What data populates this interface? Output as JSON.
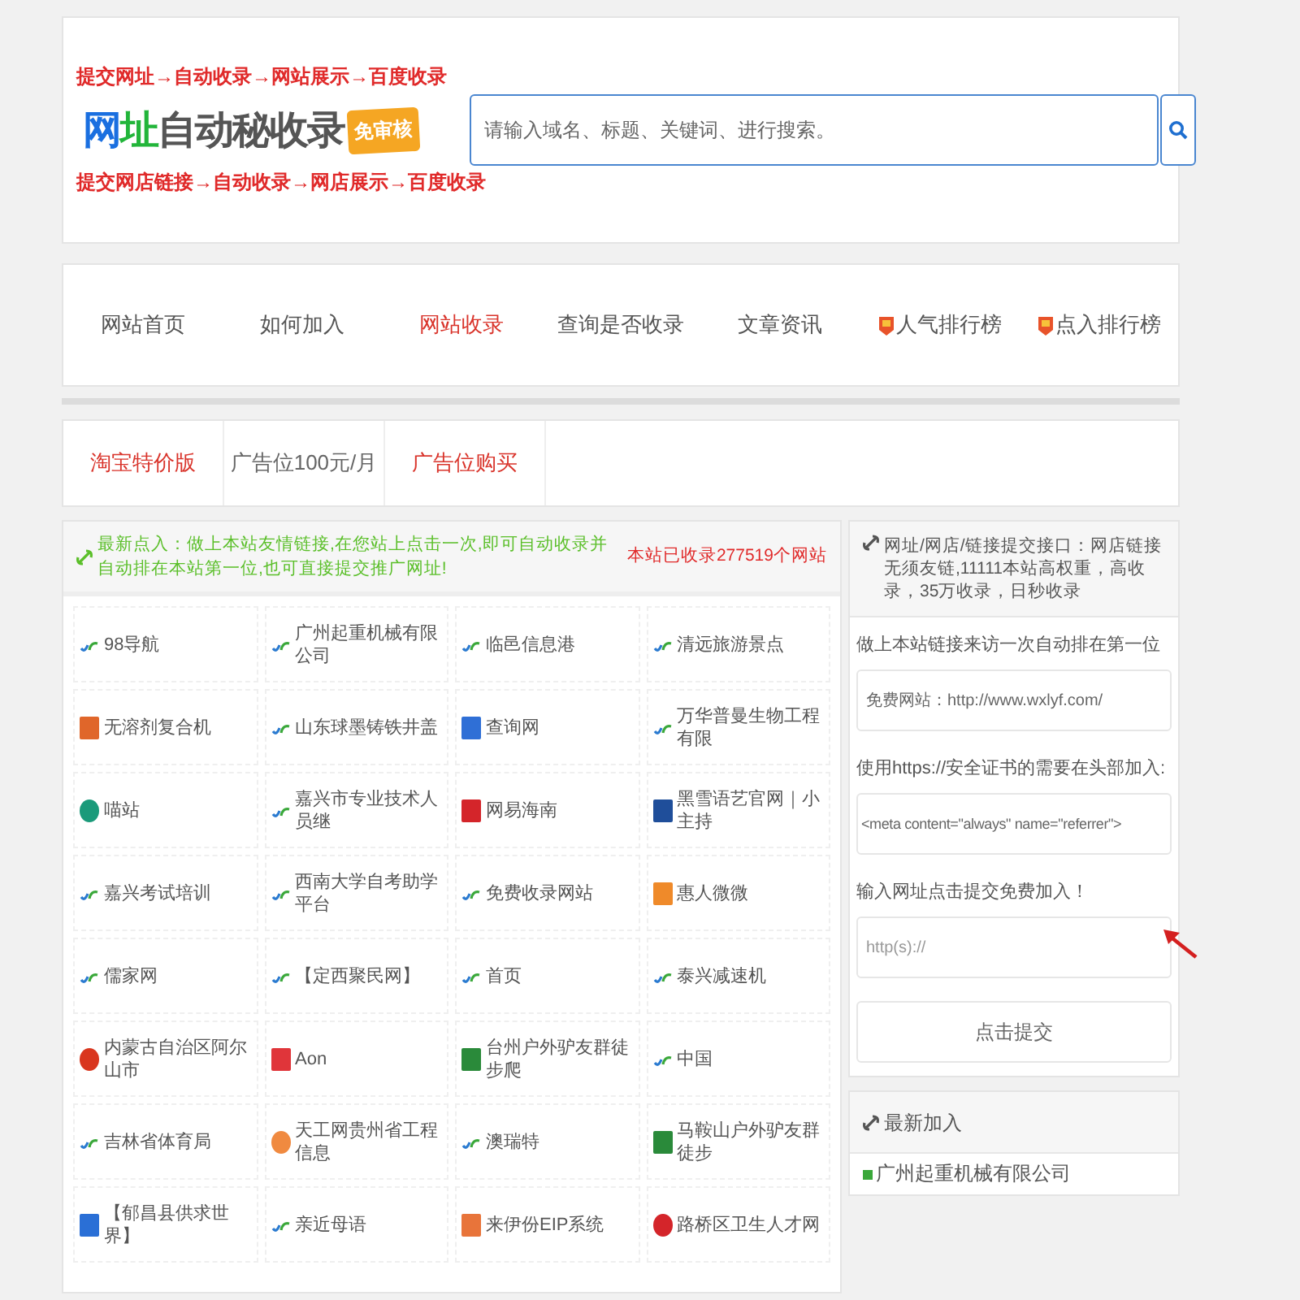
{
  "header": {
    "slogan_top": "提交网址→自动收录→网站展示→百度收录",
    "logo": {
      "parts": [
        {
          "text": "网",
          "color": "#1a6fe0"
        },
        {
          "text": "址",
          "color": "#22b53a"
        },
        {
          "text": "自动秘收录",
          "color": "#555555"
        }
      ],
      "badge": "免审核"
    },
    "slogan_bottom": "提交网店链接→自动收录→网店展示→百度收录",
    "search": {
      "placeholder": "请输入域名、标题、关键词、进行搜索。"
    }
  },
  "nav": [
    {
      "label": "网站首页",
      "selected": false,
      "kind": "plain"
    },
    {
      "label": "如何加入",
      "selected": false,
      "kind": "plain"
    },
    {
      "label": "网站收录",
      "selected": true,
      "kind": "plain"
    },
    {
      "label": "查询是否收录",
      "selected": false,
      "kind": "plain"
    },
    {
      "label": "文章资讯",
      "selected": false,
      "kind": "plain"
    },
    {
      "label": "人气排行榜",
      "selected": false,
      "kind": "hot"
    },
    {
      "label": "点入排行榜",
      "selected": false,
      "kind": "hot"
    }
  ],
  "ad_bar": [
    {
      "label": "淘宝特价版",
      "highlight": true
    },
    {
      "label": "广告位100元/月",
      "highlight": false
    },
    {
      "label": "广告位购买",
      "highlight": true
    }
  ],
  "notice": {
    "text": "最新点入：做上本站友情链接,在您站上点击一次,即可自动收录并自动排在本站第一位,也可直接提交推广网址!",
    "count": "本站已收录277519个网站"
  },
  "sites": [
    {
      "name": "98导航",
      "kind": "default"
    },
    {
      "name": "广州起重机械有限公司",
      "kind": "default"
    },
    {
      "name": "临邑信息港",
      "kind": "default"
    },
    {
      "name": "清远旅游景点",
      "kind": "default"
    },
    {
      "name": "无溶剂复合机",
      "kind": "tile",
      "color": "#e0662a"
    },
    {
      "name": "山东球墨铸铁井盖",
      "kind": "default"
    },
    {
      "name": "查询网",
      "kind": "tile",
      "color": "#2f6fd6"
    },
    {
      "name": "万华普曼生物工程有限",
      "kind": "default"
    },
    {
      "name": "喵站",
      "kind": "round",
      "color": "#1a9a7a"
    },
    {
      "name": "嘉兴市专业技术人员继",
      "kind": "default"
    },
    {
      "name": "网易海南",
      "kind": "tile",
      "color": "#d4252a"
    },
    {
      "name": "黑雪语艺官网｜小主持",
      "kind": "tile",
      "color": "#1f4e9a"
    },
    {
      "name": "嘉兴考试培训",
      "kind": "default"
    },
    {
      "name": "西南大学自考助学平台",
      "kind": "default"
    },
    {
      "name": "免费收录网站",
      "kind": "default"
    },
    {
      "name": "惠人微微",
      "kind": "tile",
      "color": "#ef8a2a"
    },
    {
      "name": "儒家网",
      "kind": "default"
    },
    {
      "name": "【定西聚民网】",
      "kind": "default"
    },
    {
      "name": "首页",
      "kind": "default"
    },
    {
      "name": "泰兴减速机",
      "kind": "default"
    },
    {
      "name": "内蒙古自治区阿尔山市",
      "kind": "round",
      "color": "#d9361e"
    },
    {
      "name": "Aon",
      "kind": "tile",
      "color": "#e0353a"
    },
    {
      "name": "台州户外驴友群徒步爬",
      "kind": "tile",
      "color": "#2a8a3a"
    },
    {
      "name": "中国",
      "kind": "default"
    },
    {
      "name": "吉林省体育局",
      "kind": "default"
    },
    {
      "name": "天工网贵州省工程信息",
      "kind": "round",
      "color": "#f08a40"
    },
    {
      "name": "澳瑞特",
      "kind": "default"
    },
    {
      "name": "马鞍山户外驴友群徒步",
      "kind": "tile",
      "color": "#2a8a3a"
    },
    {
      "name": "【郁昌县供求世界】",
      "kind": "tile",
      "color": "#2a6fd6"
    },
    {
      "name": "亲近母语",
      "kind": "default"
    },
    {
      "name": "来伊份EIP系统",
      "kind": "tile",
      "color": "#e8743a"
    },
    {
      "name": "路桥区卫生人才网",
      "kind": "round",
      "color": "#d4252a"
    }
  ],
  "submit_panel": {
    "title": "网址/网店/链接提交接口：网店链接无须友链,11111本站高权重，高收录，35万收录，日秒收录",
    "step1": "做上本站链接来访一次自动排在第一位",
    "link_value": "免费网站：http://www.wxlyf.com/",
    "step2": "使用https://安全证书的需要在头部加入:",
    "meta_value": "<meta content=\"always\" name=\"referrer\">",
    "step3": "输入网址点击提交免费加入！",
    "url_placeholder": "http(s)://",
    "button": "点击提交"
  },
  "latest": {
    "title": "最新加入",
    "items": [
      "广州起重机械有限公司"
    ]
  }
}
